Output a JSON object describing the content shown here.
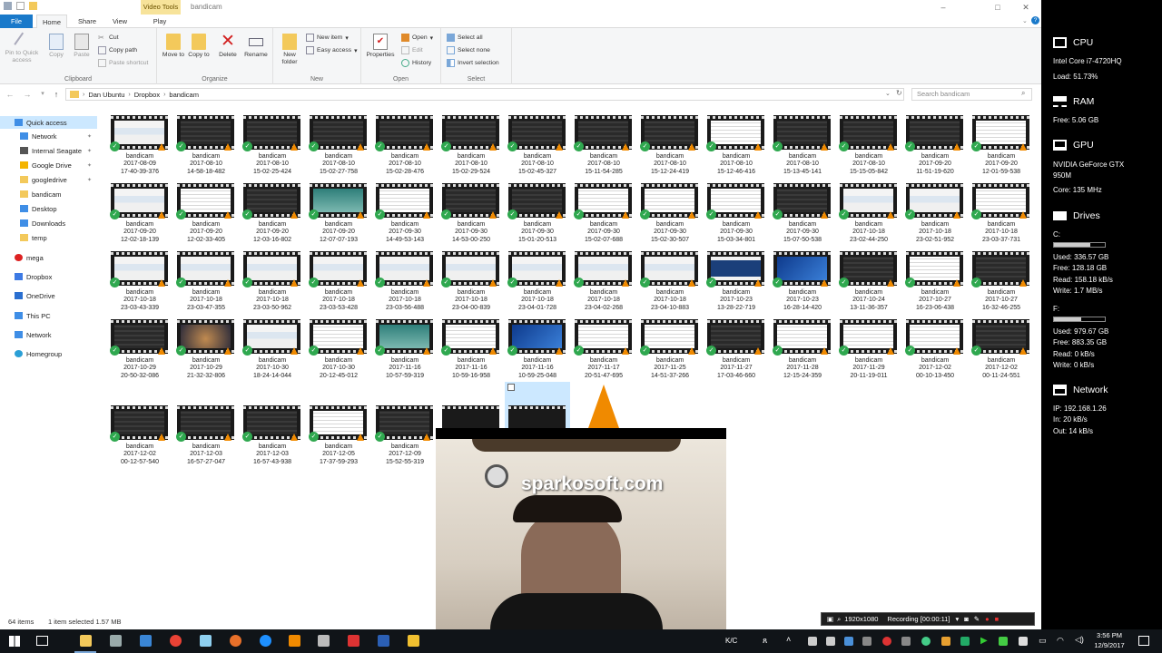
{
  "window": {
    "title": "bandicam",
    "context_tab": "Video Tools",
    "controls": [
      "–",
      "□",
      "✕"
    ]
  },
  "ribbon_tabs": [
    "File",
    "Home",
    "Share",
    "View",
    "Play"
  ],
  "ribbon": {
    "clipboard": {
      "label": "Clipboard",
      "pin": "Pin to Quick access",
      "copy": "Copy",
      "paste": "Paste",
      "cut": "Cut",
      "copy_path": "Copy path",
      "paste_shortcut": "Paste shortcut"
    },
    "organize": {
      "label": "Organize",
      "move_to": "Move to",
      "copy_to": "Copy to",
      "delete": "Delete",
      "rename": "Rename"
    },
    "new": {
      "label": "New",
      "new_folder": "New folder",
      "new_item": "New item",
      "easy_access": "Easy access"
    },
    "open": {
      "label": "Open",
      "properties": "Properties",
      "open": "Open",
      "edit": "Edit",
      "history": "History"
    },
    "select": {
      "label": "Select",
      "select_all": "Select all",
      "select_none": "Select none",
      "invert": "Invert selection"
    }
  },
  "address": {
    "crumbs": [
      "Dan Ubuntu",
      "Dropbox",
      "bandicam"
    ],
    "search_placeholder": "Search bandicam"
  },
  "nav": {
    "items": [
      {
        "label": "Quick access",
        "pinned": false,
        "selected": true,
        "indent": 0
      },
      {
        "label": "Network",
        "pinned": true,
        "selected": false,
        "indent": 1
      },
      {
        "label": "Internal Seagate",
        "pinned": true,
        "selected": false,
        "indent": 1
      },
      {
        "label": "Google Drive",
        "pinned": true,
        "selected": false,
        "indent": 1
      },
      {
        "label": "googledrive",
        "pinned": true,
        "selected": false,
        "indent": 1
      },
      {
        "label": "bandicam",
        "pinned": false,
        "selected": false,
        "indent": 1
      },
      {
        "label": "Desktop",
        "pinned": false,
        "selected": false,
        "indent": 1
      },
      {
        "label": "Downloads",
        "pinned": false,
        "selected": false,
        "indent": 1
      },
      {
        "label": "temp",
        "pinned": false,
        "selected": false,
        "indent": 1
      },
      {
        "label": "mega",
        "pinned": false,
        "selected": false,
        "indent": 0
      },
      {
        "label": "Dropbox",
        "pinned": false,
        "selected": false,
        "indent": 0
      },
      {
        "label": "OneDrive",
        "pinned": false,
        "selected": false,
        "indent": 0
      },
      {
        "label": "This PC",
        "pinned": false,
        "selected": false,
        "indent": 0
      },
      {
        "label": "Network",
        "pinned": false,
        "selected": false,
        "indent": 0
      },
      {
        "label": "Homegroup",
        "pinned": false,
        "selected": false,
        "indent": 0
      }
    ]
  },
  "files": [
    {
      "name": "bandicam",
      "date": "2017-08-09",
      "time": "17-40-39-376",
      "tone": "light"
    },
    {
      "name": "bandicam",
      "date": "2017-08-10",
      "time": "14-58-18-482",
      "tone": "dark"
    },
    {
      "name": "bandicam",
      "date": "2017-08-10",
      "time": "15-02-25-424",
      "tone": "dark"
    },
    {
      "name": "bandicam",
      "date": "2017-08-10",
      "time": "15-02-27-758",
      "tone": "dark"
    },
    {
      "name": "bandicam",
      "date": "2017-08-10",
      "time": "15-02-28-476",
      "tone": "dark"
    },
    {
      "name": "bandicam",
      "date": "2017-08-10",
      "time": "15-02-29-524",
      "tone": "dark"
    },
    {
      "name": "bandicam",
      "date": "2017-08-10",
      "time": "15-02-45-327",
      "tone": "dark"
    },
    {
      "name": "bandicam",
      "date": "2017-08-10",
      "time": "15-11-54-285",
      "tone": "dark"
    },
    {
      "name": "bandicam",
      "date": "2017-08-10",
      "time": "15-12-24-419",
      "tone": "dark"
    },
    {
      "name": "bandicam",
      "date": "2017-08-10",
      "time": "15-12-46-416",
      "tone": "white"
    },
    {
      "name": "bandicam",
      "date": "2017-08-10",
      "time": "15-13-45-141",
      "tone": "dark"
    },
    {
      "name": "bandicam",
      "date": "2017-08-10",
      "time": "15-15-05-842",
      "tone": "dark"
    },
    {
      "name": "bandicam",
      "date": "2017-09-20",
      "time": "11-51-19-620",
      "tone": "dark"
    },
    {
      "name": "bandicam",
      "date": "2017-09-20",
      "time": "12-01-59-538",
      "tone": "white"
    },
    {
      "name": "bandicam",
      "date": "2017-09-20",
      "time": "12-02-18-139",
      "tone": "light"
    },
    {
      "name": "bandicam",
      "date": "2017-09-20",
      "time": "12-02-33-405",
      "tone": "white"
    },
    {
      "name": "bandicam",
      "date": "2017-09-20",
      "time": "12-03-16-802",
      "tone": "dark"
    },
    {
      "name": "bandicam",
      "date": "2017-09-20",
      "time": "12-07-07-193",
      "tone": "teal"
    },
    {
      "name": "bandicam",
      "date": "2017-09-30",
      "time": "14-49-53-143",
      "tone": "white"
    },
    {
      "name": "bandicam",
      "date": "2017-09-30",
      "time": "14-53-00-250",
      "tone": "dark"
    },
    {
      "name": "bandicam",
      "date": "2017-09-30",
      "time": "15-01-20-513",
      "tone": "dark"
    },
    {
      "name": "bandicam",
      "date": "2017-09-30",
      "time": "15-02-07-688",
      "tone": "white"
    },
    {
      "name": "bandicam",
      "date": "2017-09-30",
      "time": "15-02-30-507",
      "tone": "white"
    },
    {
      "name": "bandicam",
      "date": "2017-09-30",
      "time": "15-03-34-801",
      "tone": "white"
    },
    {
      "name": "bandicam",
      "date": "2017-09-30",
      "time": "15-07-50-538",
      "tone": "dark"
    },
    {
      "name": "bandicam",
      "date": "2017-10-18",
      "time": "23-02-44-250",
      "tone": "light"
    },
    {
      "name": "bandicam",
      "date": "2017-10-18",
      "time": "23-02-51-952",
      "tone": "light"
    },
    {
      "name": "bandicam",
      "date": "2017-10-18",
      "time": "23-03-37-731",
      "tone": "white"
    },
    {
      "name": "bandicam",
      "date": "2017-10-18",
      "time": "23-03-43-339",
      "tone": "light"
    },
    {
      "name": "bandicam",
      "date": "2017-10-18",
      "time": "23-03-47-355",
      "tone": "light"
    },
    {
      "name": "bandicam",
      "date": "2017-10-18",
      "time": "23-03-50-962",
      "tone": "light"
    },
    {
      "name": "bandicam",
      "date": "2017-10-18",
      "time": "23-03-53-428",
      "tone": "light"
    },
    {
      "name": "bandicam",
      "date": "2017-10-18",
      "time": "23-03-56-488",
      "tone": "light"
    },
    {
      "name": "bandicam",
      "date": "2017-10-18",
      "time": "23-04-00-839",
      "tone": "light"
    },
    {
      "name": "bandicam",
      "date": "2017-10-18",
      "time": "23-04-01-728",
      "tone": "light"
    },
    {
      "name": "bandicam",
      "date": "2017-10-18",
      "time": "23-04-02-268",
      "tone": "light"
    },
    {
      "name": "bandicam",
      "date": "2017-10-18",
      "time": "23-04-10-883",
      "tone": "light"
    },
    {
      "name": "bandicam",
      "date": "2017-10-23",
      "time": "13-28-22-719",
      "tone": "monitor"
    },
    {
      "name": "bandicam",
      "date": "2017-10-23",
      "time": "16-28-14-420",
      "tone": "blue"
    },
    {
      "name": "bandicam",
      "date": "2017-10-24",
      "time": "13-11-36-357",
      "tone": "dark"
    },
    {
      "name": "bandicam",
      "date": "2017-10-27",
      "time": "16-23-06-438",
      "tone": "white"
    },
    {
      "name": "bandicam",
      "date": "2017-10-27",
      "time": "16-32-46-255",
      "tone": "dark"
    },
    {
      "name": "bandicam",
      "date": "2017-10-29",
      "time": "20-50-32-086",
      "tone": "dark"
    },
    {
      "name": "bandicam",
      "date": "2017-10-29",
      "time": "21-32-32-806",
      "tone": "photo"
    },
    {
      "name": "bandicam",
      "date": "2017-10-30",
      "time": "18-24-14-044",
      "tone": "light"
    },
    {
      "name": "bandicam",
      "date": "2017-10-30",
      "time": "20-12-45-012",
      "tone": "white"
    },
    {
      "name": "bandicam",
      "date": "2017-11-16",
      "time": "10-57-59-319",
      "tone": "teal"
    },
    {
      "name": "bandicam",
      "date": "2017-11-16",
      "time": "10-59-16-958",
      "tone": "white"
    },
    {
      "name": "bandicam",
      "date": "2017-11-16",
      "time": "10-59-25-048",
      "tone": "blue"
    },
    {
      "name": "bandicam",
      "date": "2017-11-17",
      "time": "20-51-47-695",
      "tone": "white"
    },
    {
      "name": "bandicam",
      "date": "2017-11-25",
      "time": "14-51-37-266",
      "tone": "white"
    },
    {
      "name": "bandicam",
      "date": "2017-11-27",
      "time": "17-03-46-660",
      "tone": "dark"
    },
    {
      "name": "bandicam",
      "date": "2017-11-28",
      "time": "12-15-24-359",
      "tone": "white"
    },
    {
      "name": "bandicam",
      "date": "2017-11-29",
      "time": "20-11-19-011",
      "tone": "white"
    },
    {
      "name": "bandicam",
      "date": "2017-12-02",
      "time": "00-10-13-450",
      "tone": "white"
    },
    {
      "name": "bandicam",
      "date": "2017-12-02",
      "time": "00-11-24-551",
      "tone": "dark"
    },
    {
      "name": "bandicam",
      "date": "2017-12-02",
      "time": "00-12-57-540",
      "tone": "dark"
    },
    {
      "name": "bandicam",
      "date": "2017-12-03",
      "time": "16-57-27-047",
      "tone": "dark"
    },
    {
      "name": "bandicam",
      "date": "2017-12-03",
      "time": "16-57-43-938",
      "tone": "dark"
    },
    {
      "name": "bandicam",
      "date": "2017-12-05",
      "time": "17-37-59-293",
      "tone": "white"
    },
    {
      "name": "bandicam",
      "date": "2017-12-09",
      "time": "15-52-55-319",
      "tone": "dark"
    }
  ],
  "status": {
    "item_count": "64 items",
    "selection": "1 item selected  1.57 MB"
  },
  "sidebar": {
    "cpu": {
      "title": "CPU",
      "model": "Intel Core i7-4720HQ",
      "load": "Load: 51.73%"
    },
    "ram": {
      "title": "RAM",
      "free": "Free: 5.06 GB"
    },
    "gpu": {
      "title": "GPU",
      "model_line1": "NVIDIA GeForce GTX",
      "model_line2": "950M",
      "core": "Core: 135 MHz"
    },
    "drives": {
      "title": "Drives",
      "c": {
        "letter": "C:",
        "used": "Used: 336.57 GB",
        "free": "Free: 128.18 GB",
        "read": "Read: 158.18 kB/s",
        "write": "Write: 1.7 MB/s",
        "used_fraction": 0.72
      },
      "f": {
        "letter": "F:",
        "used": "Used: 979.67 GB",
        "free": "Free: 883.35 GB",
        "read": "Read: 0 kB/s",
        "write": "Write: 0 kB/s",
        "used_fraction": 0.53
      }
    },
    "network": {
      "title": "Network",
      "ip": "IP: 192.168.1.26",
      "in": "In: 20 kB/s",
      "out": "Out: 14 kB/s"
    }
  },
  "overlay": {
    "watermark": "sparkosoft.com",
    "resolution": "1920x1080",
    "recording": "Recording [00:00:11]"
  },
  "taskbar": {
    "time": "3:56 PM",
    "date": "12/9/2017",
    "input": "K/C"
  }
}
